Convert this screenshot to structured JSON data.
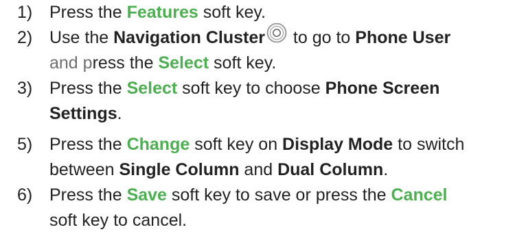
{
  "steps": [
    {
      "num": "1)",
      "lines": [
        [
          {
            "t": "Press the ",
            "s": ""
          },
          {
            "t": "Features",
            "s": "g"
          },
          {
            "t": " soft key.",
            "s": ""
          }
        ]
      ]
    },
    {
      "num": "2)",
      "lines": [
        [
          {
            "t": "Use the ",
            "s": ""
          },
          {
            "t": "Navigation Cluster",
            "s": "b"
          },
          {
            "t": "",
            "s": "icon",
            "icon": "navigation-cluster-icon"
          },
          {
            "t": " to go to ",
            "s": ""
          },
          {
            "t": "Phone User",
            "s": "b"
          }
        ],
        [
          {
            "t": "and p",
            "s": "muted"
          },
          {
            "t": "ress the ",
            "s": ""
          },
          {
            "t": "Select",
            "s": "g"
          },
          {
            "t": " soft key.",
            "s": ""
          }
        ]
      ]
    },
    {
      "num": "3)",
      "lines": [
        [
          {
            "t": "Press the ",
            "s": ""
          },
          {
            "t": "Select",
            "s": "g"
          },
          {
            "t": " soft key to choose ",
            "s": ""
          },
          {
            "t": "Phone Screen",
            "s": "b"
          }
        ],
        [
          {
            "t": "Settings",
            "s": "b"
          },
          {
            "t": ".",
            "s": ""
          }
        ]
      ]
    },
    {
      "num": "5)",
      "lines": [
        [
          {
            "t": "Press the ",
            "s": ""
          },
          {
            "t": "Change",
            "s": "g"
          },
          {
            "t": " soft key on ",
            "s": ""
          },
          {
            "t": "Display Mode",
            "s": "b"
          },
          {
            "t": " to switch",
            "s": ""
          }
        ],
        [
          {
            "t": "between ",
            "s": ""
          },
          {
            "t": "Single Column",
            "s": "b"
          },
          {
            "t": " and ",
            "s": ""
          },
          {
            "t": "Dual Column",
            "s": "b"
          },
          {
            "t": ".",
            "s": ""
          }
        ]
      ]
    },
    {
      "num": "6)",
      "lines": [
        [
          {
            "t": "Press the ",
            "s": ""
          },
          {
            "t": "Save",
            "s": "g"
          },
          {
            "t": " soft key to save or press the ",
            "s": ""
          },
          {
            "t": "Cancel",
            "s": "g"
          }
        ],
        [
          {
            "t": "soft key to cancel.",
            "s": ""
          }
        ]
      ]
    }
  ],
  "colors": {
    "accent_green": "#4caf50",
    "text": "#222222"
  }
}
